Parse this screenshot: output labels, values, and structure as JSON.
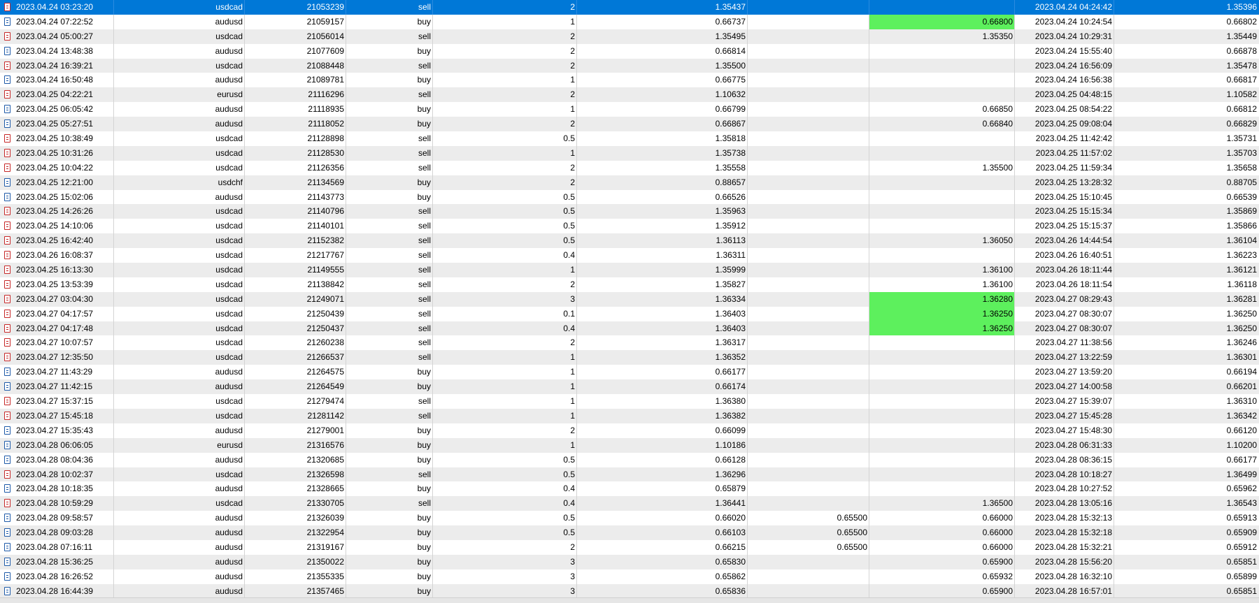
{
  "colors": {
    "selected_row": "#0078d7",
    "highlight": "#5df05d",
    "alt_row": "#ececec",
    "sell_icon": "#c62828",
    "buy_icon": "#1e5aa8"
  },
  "rows": [
    {
      "time": "2023.04.24 03:23:20",
      "symbol": "usdcad",
      "ticket": "21053239",
      "type": "sell",
      "volume": "2",
      "price": "1.35437",
      "sl": "",
      "tp": "",
      "close_time": "2023.04.24 04:24:42",
      "close_price": "1.35396",
      "selected": true
    },
    {
      "time": "2023.04.24 07:22:52",
      "symbol": "audusd",
      "ticket": "21059157",
      "type": "buy",
      "volume": "1",
      "price": "0.66737",
      "sl": "",
      "tp": "0.66800",
      "tp_highlight": true,
      "close_time": "2023.04.24 10:24:54",
      "close_price": "0.66802"
    },
    {
      "time": "2023.04.24 05:00:27",
      "symbol": "usdcad",
      "ticket": "21056014",
      "type": "sell",
      "volume": "2",
      "price": "1.35495",
      "sl": "",
      "tp": "1.35350",
      "close_time": "2023.04.24 10:29:31",
      "close_price": "1.35449"
    },
    {
      "time": "2023.04.24 13:48:38",
      "symbol": "audusd",
      "ticket": "21077609",
      "type": "buy",
      "volume": "2",
      "price": "0.66814",
      "sl": "",
      "tp": "",
      "close_time": "2023.04.24 15:55:40",
      "close_price": "0.66878"
    },
    {
      "time": "2023.04.24 16:39:21",
      "symbol": "usdcad",
      "ticket": "21088448",
      "type": "sell",
      "volume": "2",
      "price": "1.35500",
      "sl": "",
      "tp": "",
      "close_time": "2023.04.24 16:56:09",
      "close_price": "1.35478"
    },
    {
      "time": "2023.04.24 16:50:48",
      "symbol": "audusd",
      "ticket": "21089781",
      "type": "buy",
      "volume": "1",
      "price": "0.66775",
      "sl": "",
      "tp": "",
      "close_time": "2023.04.24 16:56:38",
      "close_price": "0.66817"
    },
    {
      "time": "2023.04.25 04:22:21",
      "symbol": "eurusd",
      "ticket": "21116296",
      "type": "sell",
      "volume": "2",
      "price": "1.10632",
      "sl": "",
      "tp": "",
      "close_time": "2023.04.25 04:48:15",
      "close_price": "1.10582"
    },
    {
      "time": "2023.04.25 06:05:42",
      "symbol": "audusd",
      "ticket": "21118935",
      "type": "buy",
      "volume": "1",
      "price": "0.66799",
      "sl": "",
      "tp": "0.66850",
      "close_time": "2023.04.25 08:54:22",
      "close_price": "0.66812"
    },
    {
      "time": "2023.04.25 05:27:51",
      "symbol": "audusd",
      "ticket": "21118052",
      "type": "buy",
      "volume": "2",
      "price": "0.66867",
      "sl": "",
      "tp": "0.66840",
      "close_time": "2023.04.25 09:08:04",
      "close_price": "0.66829"
    },
    {
      "time": "2023.04.25 10:38:49",
      "symbol": "usdcad",
      "ticket": "21128898",
      "type": "sell",
      "volume": "0.5",
      "price": "1.35818",
      "sl": "",
      "tp": "",
      "close_time": "2023.04.25 11:42:42",
      "close_price": "1.35731"
    },
    {
      "time": "2023.04.25 10:31:26",
      "symbol": "usdcad",
      "ticket": "21128530",
      "type": "sell",
      "volume": "1",
      "price": "1.35738",
      "sl": "",
      "tp": "",
      "close_time": "2023.04.25 11:57:02",
      "close_price": "1.35703"
    },
    {
      "time": "2023.04.25 10:04:22",
      "symbol": "usdcad",
      "ticket": "21126356",
      "type": "sell",
      "volume": "2",
      "price": "1.35558",
      "sl": "",
      "tp": "1.35500",
      "close_time": "2023.04.25 11:59:34",
      "close_price": "1.35658"
    },
    {
      "time": "2023.04.25 12:21:00",
      "symbol": "usdchf",
      "ticket": "21134569",
      "type": "buy",
      "volume": "2",
      "price": "0.88657",
      "sl": "",
      "tp": "",
      "close_time": "2023.04.25 13:28:32",
      "close_price": "0.88705"
    },
    {
      "time": "2023.04.25 15:02:06",
      "symbol": "audusd",
      "ticket": "21143773",
      "type": "buy",
      "volume": "0.5",
      "price": "0.66526",
      "sl": "",
      "tp": "",
      "close_time": "2023.04.25 15:10:45",
      "close_price": "0.66539"
    },
    {
      "time": "2023.04.25 14:26:26",
      "symbol": "usdcad",
      "ticket": "21140796",
      "type": "sell",
      "volume": "0.5",
      "price": "1.35963",
      "sl": "",
      "tp": "",
      "close_time": "2023.04.25 15:15:34",
      "close_price": "1.35869"
    },
    {
      "time": "2023.04.25 14:10:06",
      "symbol": "usdcad",
      "ticket": "21140101",
      "type": "sell",
      "volume": "0.5",
      "price": "1.35912",
      "sl": "",
      "tp": "",
      "close_time": "2023.04.25 15:15:37",
      "close_price": "1.35866"
    },
    {
      "time": "2023.04.25 16:42:40",
      "symbol": "usdcad",
      "ticket": "21152382",
      "type": "sell",
      "volume": "0.5",
      "price": "1.36113",
      "sl": "",
      "tp": "1.36050",
      "close_time": "2023.04.26 14:44:54",
      "close_price": "1.36104"
    },
    {
      "time": "2023.04.26 16:08:37",
      "symbol": "usdcad",
      "ticket": "21217767",
      "type": "sell",
      "volume": "0.4",
      "price": "1.36311",
      "sl": "",
      "tp": "",
      "close_time": "2023.04.26 16:40:51",
      "close_price": "1.36223"
    },
    {
      "time": "2023.04.25 16:13:30",
      "symbol": "usdcad",
      "ticket": "21149555",
      "type": "sell",
      "volume": "1",
      "price": "1.35999",
      "sl": "",
      "tp": "1.36100",
      "close_time": "2023.04.26 18:11:44",
      "close_price": "1.36121"
    },
    {
      "time": "2023.04.25 13:53:39",
      "symbol": "usdcad",
      "ticket": "21138842",
      "type": "sell",
      "volume": "2",
      "price": "1.35827",
      "sl": "",
      "tp": "1.36100",
      "close_time": "2023.04.26 18:11:54",
      "close_price": "1.36118"
    },
    {
      "time": "2023.04.27 03:04:30",
      "symbol": "usdcad",
      "ticket": "21249071",
      "type": "sell",
      "volume": "3",
      "price": "1.36334",
      "sl": "",
      "tp": "1.36280",
      "tp_highlight": true,
      "close_time": "2023.04.27 08:29:43",
      "close_price": "1.36281"
    },
    {
      "time": "2023.04.27 04:17:57",
      "symbol": "usdcad",
      "ticket": "21250439",
      "type": "sell",
      "volume": "0.1",
      "price": "1.36403",
      "sl": "",
      "tp": "1.36250",
      "tp_highlight": true,
      "close_time": "2023.04.27 08:30:07",
      "close_price": "1.36250"
    },
    {
      "time": "2023.04.27 04:17:48",
      "symbol": "usdcad",
      "ticket": "21250437",
      "type": "sell",
      "volume": "0.4",
      "price": "1.36403",
      "sl": "",
      "tp": "1.36250",
      "tp_highlight": true,
      "close_time": "2023.04.27 08:30:07",
      "close_price": "1.36250"
    },
    {
      "time": "2023.04.27 10:07:57",
      "symbol": "usdcad",
      "ticket": "21260238",
      "type": "sell",
      "volume": "2",
      "price": "1.36317",
      "sl": "",
      "tp": "",
      "close_time": "2023.04.27 11:38:56",
      "close_price": "1.36246"
    },
    {
      "time": "2023.04.27 12:35:50",
      "symbol": "usdcad",
      "ticket": "21266537",
      "type": "sell",
      "volume": "1",
      "price": "1.36352",
      "sl": "",
      "tp": "",
      "close_time": "2023.04.27 13:22:59",
      "close_price": "1.36301"
    },
    {
      "time": "2023.04.27 11:43:29",
      "symbol": "audusd",
      "ticket": "21264575",
      "type": "buy",
      "volume": "1",
      "price": "0.66177",
      "sl": "",
      "tp": "",
      "close_time": "2023.04.27 13:59:20",
      "close_price": "0.66194"
    },
    {
      "time": "2023.04.27 11:42:15",
      "symbol": "audusd",
      "ticket": "21264549",
      "type": "buy",
      "volume": "1",
      "price": "0.66174",
      "sl": "",
      "tp": "",
      "close_time": "2023.04.27 14:00:58",
      "close_price": "0.66201"
    },
    {
      "time": "2023.04.27 15:37:15",
      "symbol": "usdcad",
      "ticket": "21279474",
      "type": "sell",
      "volume": "1",
      "price": "1.36380",
      "sl": "",
      "tp": "",
      "close_time": "2023.04.27 15:39:07",
      "close_price": "1.36310"
    },
    {
      "time": "2023.04.27 15:45:18",
      "symbol": "usdcad",
      "ticket": "21281142",
      "type": "sell",
      "volume": "1",
      "price": "1.36382",
      "sl": "",
      "tp": "",
      "close_time": "2023.04.27 15:45:28",
      "close_price": "1.36342"
    },
    {
      "time": "2023.04.27 15:35:43",
      "symbol": "audusd",
      "ticket": "21279001",
      "type": "buy",
      "volume": "2",
      "price": "0.66099",
      "sl": "",
      "tp": "",
      "close_time": "2023.04.27 15:48:30",
      "close_price": "0.66120"
    },
    {
      "time": "2023.04.28 06:06:05",
      "symbol": "eurusd",
      "ticket": "21316576",
      "type": "buy",
      "volume": "1",
      "price": "1.10186",
      "sl": "",
      "tp": "",
      "close_time": "2023.04.28 06:31:33",
      "close_price": "1.10200"
    },
    {
      "time": "2023.04.28 08:04:36",
      "symbol": "audusd",
      "ticket": "21320685",
      "type": "buy",
      "volume": "0.5",
      "price": "0.66128",
      "sl": "",
      "tp": "",
      "close_time": "2023.04.28 08:36:15",
      "close_price": "0.66177"
    },
    {
      "time": "2023.04.28 10:02:37",
      "symbol": "usdcad",
      "ticket": "21326598",
      "type": "sell",
      "volume": "0.5",
      "price": "1.36296",
      "sl": "",
      "tp": "",
      "close_time": "2023.04.28 10:18:27",
      "close_price": "1.36499"
    },
    {
      "time": "2023.04.28 10:18:35",
      "symbol": "audusd",
      "ticket": "21328665",
      "type": "buy",
      "volume": "0.4",
      "price": "0.65879",
      "sl": "",
      "tp": "",
      "close_time": "2023.04.28 10:27:52",
      "close_price": "0.65962"
    },
    {
      "time": "2023.04.28 10:59:29",
      "symbol": "usdcad",
      "ticket": "21330705",
      "type": "sell",
      "volume": "0.4",
      "price": "1.36441",
      "sl": "",
      "tp": "1.36500",
      "close_time": "2023.04.28 13:05:16",
      "close_price": "1.36543"
    },
    {
      "time": "2023.04.28 09:58:57",
      "symbol": "audusd",
      "ticket": "21326039",
      "type": "buy",
      "volume": "0.5",
      "price": "0.66020",
      "sl": "0.65500",
      "tp": "0.66000",
      "close_time": "2023.04.28 15:32:13",
      "close_price": "0.65913"
    },
    {
      "time": "2023.04.28 09:03:28",
      "symbol": "audusd",
      "ticket": "21322954",
      "type": "buy",
      "volume": "0.5",
      "price": "0.66103",
      "sl": "0.65500",
      "tp": "0.66000",
      "close_time": "2023.04.28 15:32:18",
      "close_price": "0.65909"
    },
    {
      "time": "2023.04.28 07:16:11",
      "symbol": "audusd",
      "ticket": "21319167",
      "type": "buy",
      "volume": "2",
      "price": "0.66215",
      "sl": "0.65500",
      "tp": "0.66000",
      "close_time": "2023.04.28 15:32:21",
      "close_price": "0.65912"
    },
    {
      "time": "2023.04.28 15:36:25",
      "symbol": "audusd",
      "ticket": "21350022",
      "type": "buy",
      "volume": "3",
      "price": "0.65830",
      "sl": "",
      "tp": "0.65900",
      "close_time": "2023.04.28 15:56:20",
      "close_price": "0.65851"
    },
    {
      "time": "2023.04.28 16:26:52",
      "symbol": "audusd",
      "ticket": "21355335",
      "type": "buy",
      "volume": "3",
      "price": "0.65862",
      "sl": "",
      "tp": "0.65932",
      "close_time": "2023.04.28 16:32:10",
      "close_price": "0.65899"
    },
    {
      "time": "2023.04.28 16:44:39",
      "symbol": "audusd",
      "ticket": "21357465",
      "type": "buy",
      "volume": "3",
      "price": "0.65836",
      "sl": "",
      "tp": "0.65900",
      "close_time": "2023.04.28 16:57:01",
      "close_price": "0.65851"
    }
  ]
}
